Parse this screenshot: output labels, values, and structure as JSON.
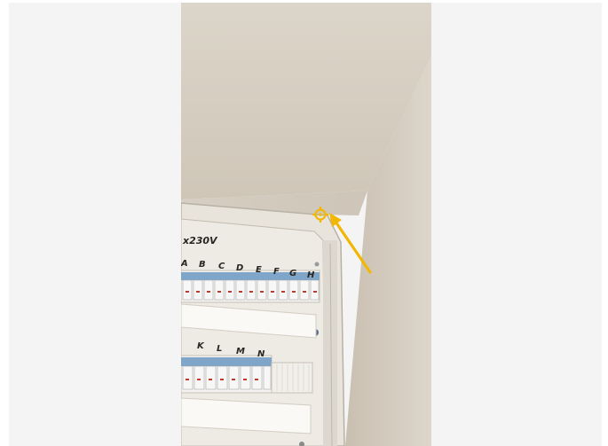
{
  "viewer": {
    "background_color": "#f4f4f4"
  },
  "photo": {
    "subject": "electrical-panel-corner",
    "marker_color": "#f2b705",
    "voltage_label": "x230V",
    "row1_labels": [
      "A",
      "B",
      "C",
      "D",
      "E",
      "F",
      "G",
      "H"
    ],
    "row2_labels": [
      "K",
      "L",
      "M",
      "N"
    ]
  }
}
